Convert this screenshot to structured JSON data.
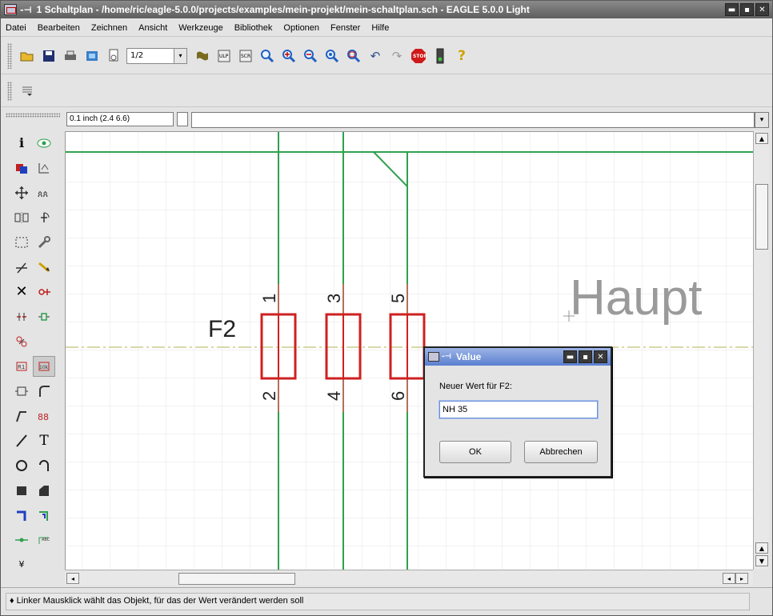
{
  "window": {
    "title": "1 Schaltplan - /home/ric/eagle-5.0.0/projects/examples/mein-projekt/mein-schaltplan.sch - EAGLE 5.0.0 Light",
    "pin_glyph": "-⊣",
    "controls": [
      "▬",
      "▪",
      "✕"
    ]
  },
  "menu": [
    "Datei",
    "Bearbeiten",
    "Zeichnen",
    "Ansicht",
    "Werkzeuge",
    "Bibliothek",
    "Optionen",
    "Fenster",
    "Hilfe"
  ],
  "toolbar": {
    "icons": [
      "open-icon",
      "save-icon",
      "print-icon",
      "cam-icon",
      "sheet-icon"
    ],
    "sheet_combo": "1/2",
    "combo_arrow": "▾",
    "undo_glyph": "↶",
    "redo_glyph": "↷",
    "help_glyph": "?"
  },
  "coords": {
    "value": "0.1 inch (2.4 6.6)",
    "cmd_arrow": "▾"
  },
  "palette": {
    "info_glyph": "i",
    "text_glyph": "T"
  },
  "schematic": {
    "part_name": "F2",
    "pins_top": [
      "1",
      "3",
      "5"
    ],
    "pins_bottom": [
      "2",
      "4",
      "6"
    ],
    "frame_text": "Haupt"
  },
  "scroll": {
    "up": "▲",
    "down": "▼",
    "left": "◂",
    "right": "▸"
  },
  "status": {
    "text": "♦ Linker Mausklick wählt das Objekt, für das der Wert verändert werden soll"
  },
  "dialog": {
    "title": "Value",
    "pin_glyph": "-⊣",
    "label": "Neuer Wert für F2:",
    "input_value": "NH 35",
    "ok_label": "OK",
    "cancel_label": "Abbrechen",
    "controls": [
      "▬",
      "▪",
      "✕"
    ]
  }
}
